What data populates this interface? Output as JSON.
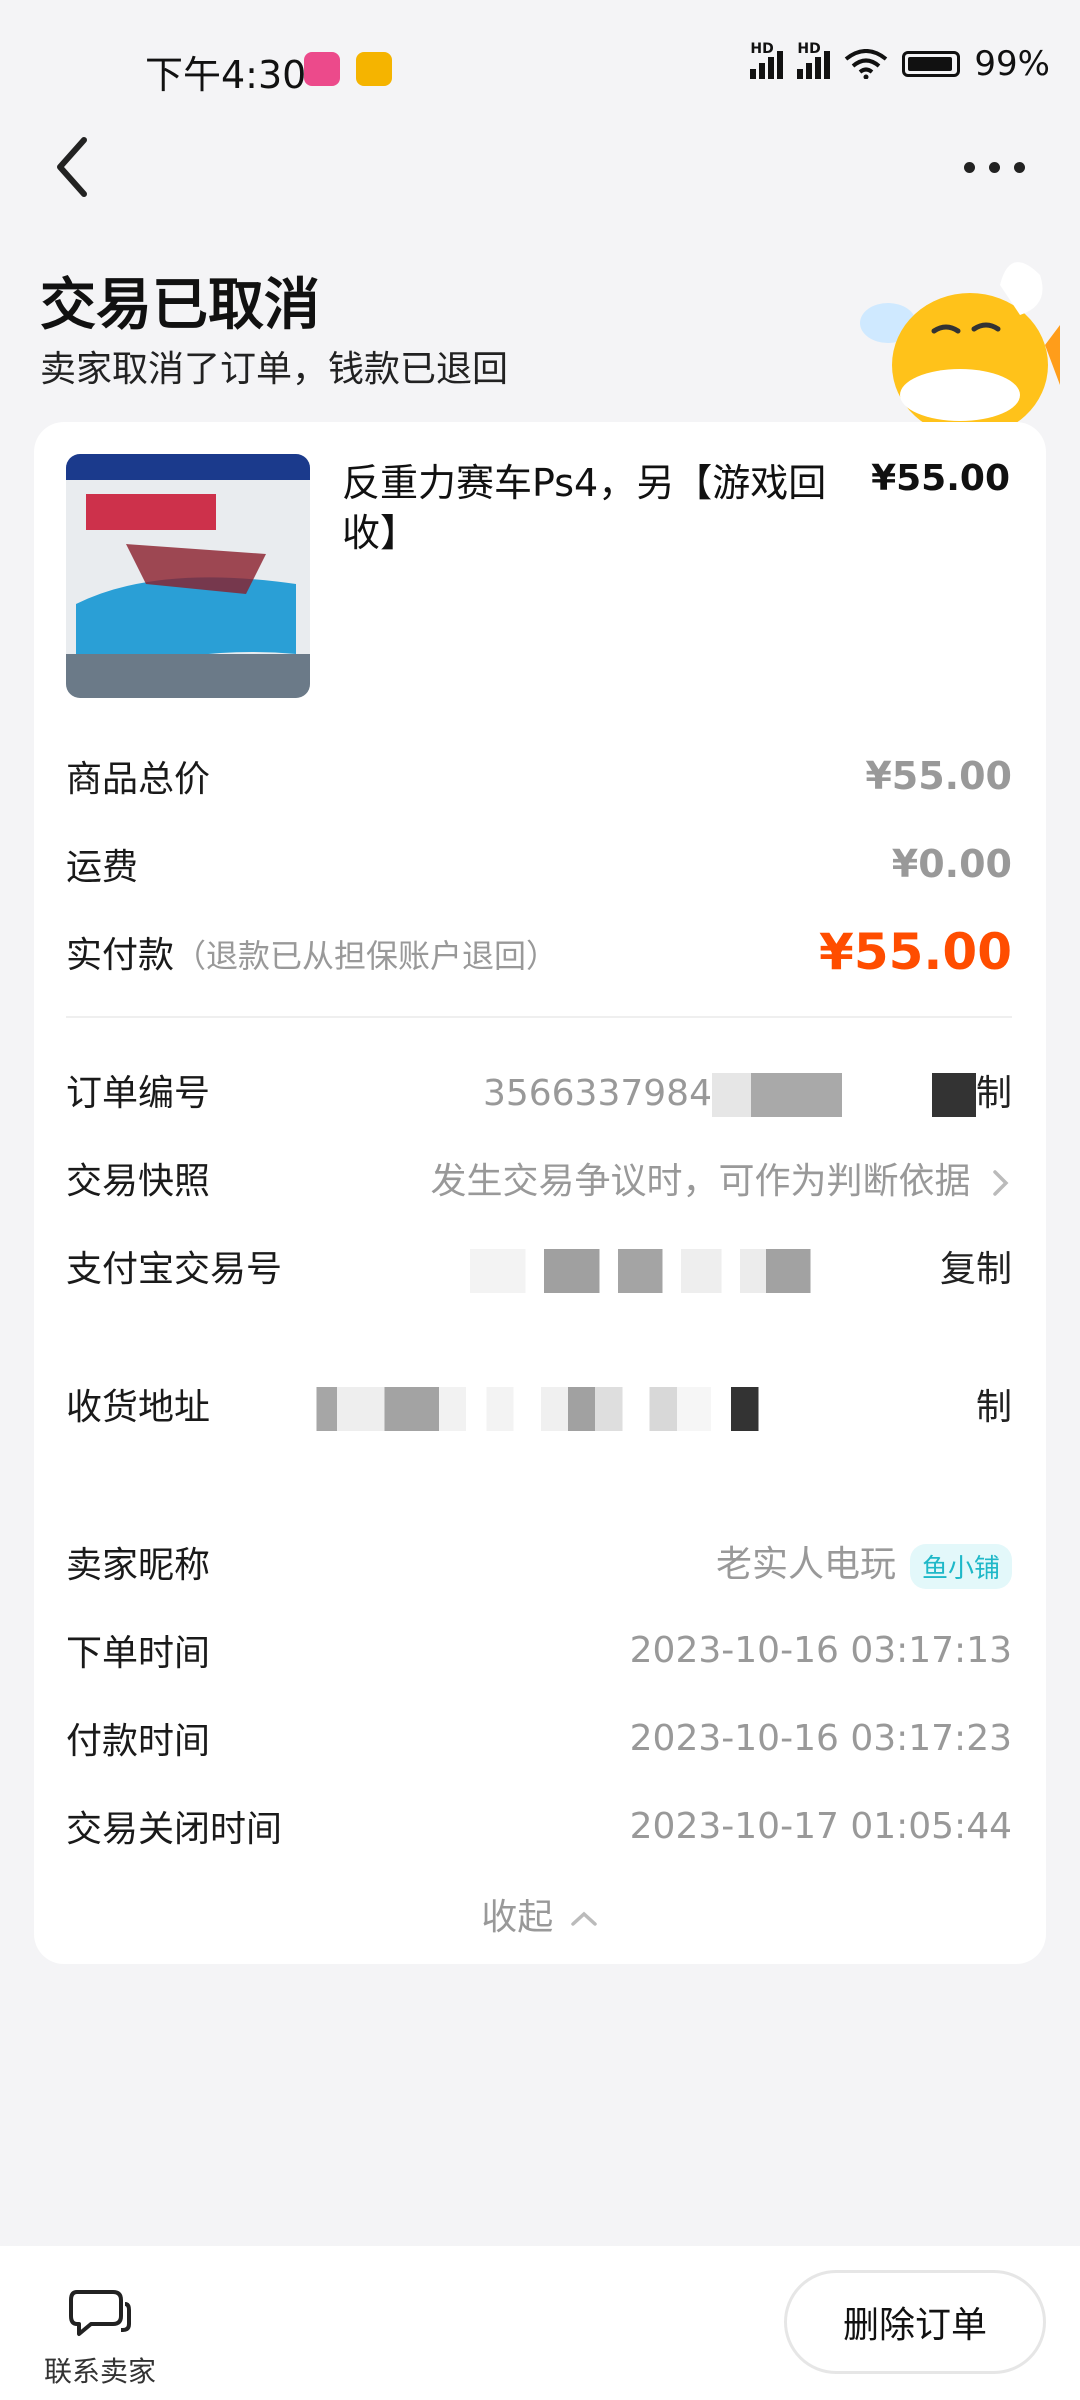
{
  "status_bar": {
    "time": "下午4:30",
    "battery": "99%",
    "network1": "HD",
    "network2": "HD"
  },
  "header": {
    "title": "交易已取消",
    "subtitle": "卖家取消了订单，钱款已退回"
  },
  "product": {
    "title": "反重力赛车Ps4，另【游戏回收】",
    "price": "¥55.00"
  },
  "summary": {
    "total_label": "商品总价",
    "total_value": "¥55.00",
    "shipping_label": "运费",
    "shipping_value": "¥0.00",
    "paid_label": "实付款",
    "paid_note": "（退款已从担保账户退回）",
    "paid_value": "¥55.00"
  },
  "details": {
    "order_no_label": "订单编号",
    "order_no_value": "3566337984",
    "copy_tail": "制",
    "snapshot_label": "交易快照",
    "snapshot_value": "发生交易争议时，可作为判断依据",
    "alipay_label": "支付宝交易号",
    "alipay_copy": "复制",
    "address_label": "收货地址",
    "address_copy_tail": "制",
    "seller_label": "卖家昵称",
    "seller_value": "老实人电玩",
    "seller_tag": "鱼小铺",
    "order_time_label": "下单时间",
    "order_time_value": "2023-10-16 03:17:13",
    "pay_time_label": "付款时间",
    "pay_time_value": "2023-10-16 03:17:23",
    "close_time_label": "交易关闭时间",
    "close_time_value": "2023-10-17 01:05:44",
    "collapse_label": "收起"
  },
  "bottom": {
    "contact_label": "联系卖家",
    "delete_label": "删除订单"
  },
  "colors": {
    "accent_red": "#ff4d00",
    "tag_teal": "#1fb8c8",
    "background": "#f4f4f6"
  },
  "icons": [
    "back-arrow-icon",
    "more-dots-icon",
    "chevron-right-icon",
    "chevron-up-icon",
    "chat-bubble-icon"
  ]
}
